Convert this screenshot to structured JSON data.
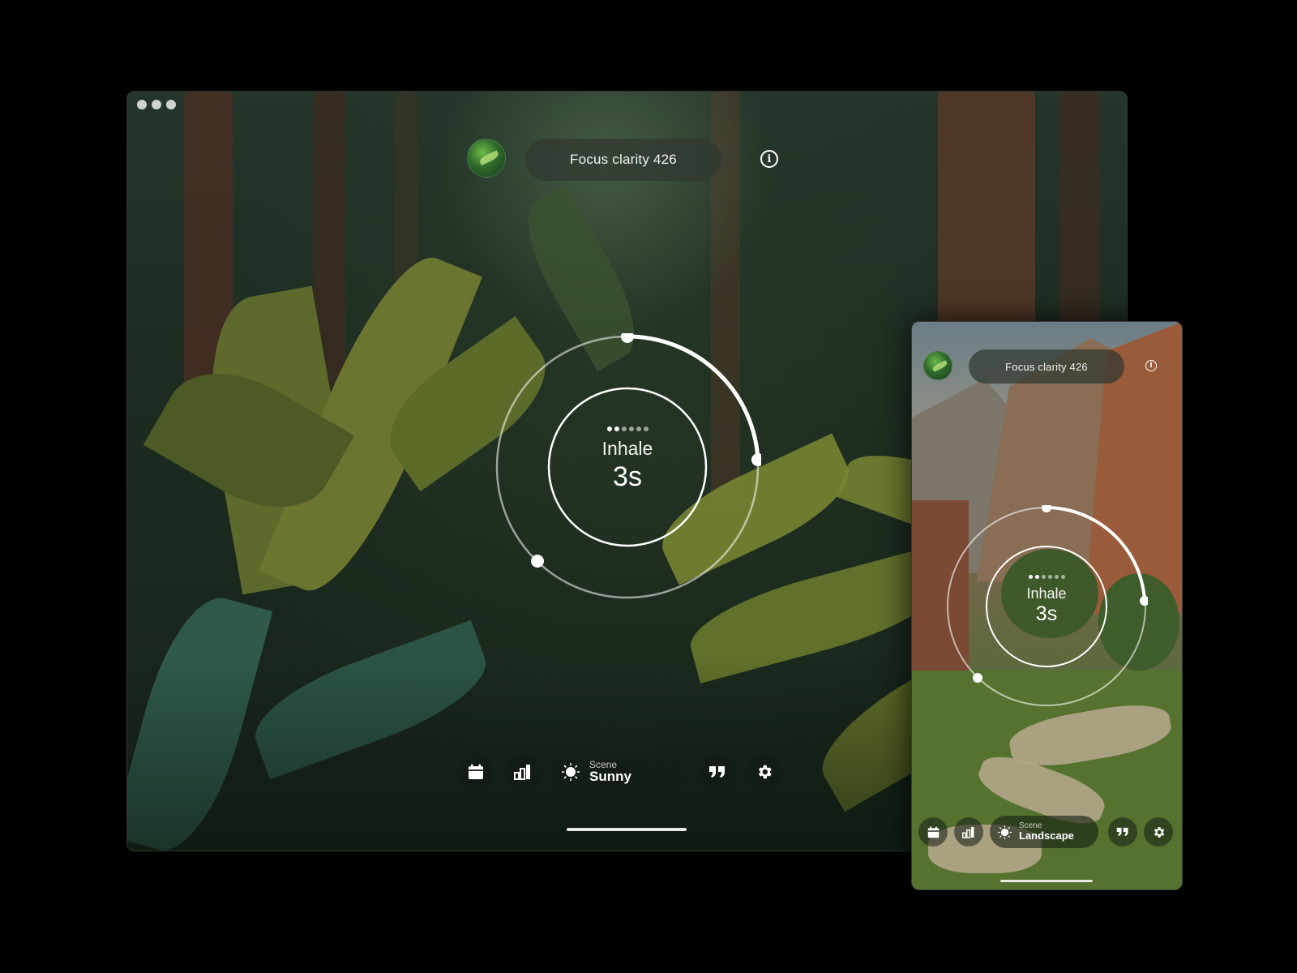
{
  "desktop": {
    "header": {
      "title": "Focus clarity 426",
      "info_icon": "info-icon",
      "avatar_icon": "fern-avatar-icon"
    },
    "breath": {
      "phase": "Inhale",
      "seconds": "3s",
      "step_dots_total": 6,
      "step_dots_active": 2,
      "progress_fraction": 0.27
    },
    "dock": {
      "calendar_icon": "calendar-icon",
      "stats_icon": "bar-chart-icon",
      "scene_icon": "sun-icon",
      "scene_label": "Scene",
      "scene_value": "Sunny",
      "quote_icon": "quote-icon",
      "settings_icon": "gear-icon"
    }
  },
  "phone": {
    "header": {
      "title": "Focus clarity 426",
      "info_icon": "info-icon",
      "avatar_icon": "fern-avatar-icon"
    },
    "breath": {
      "phase": "Inhale",
      "seconds": "3s",
      "step_dots_total": 6,
      "step_dots_active": 2,
      "progress_fraction": 0.27
    },
    "dock": {
      "calendar_icon": "calendar-icon",
      "stats_icon": "bar-chart-icon",
      "scene_icon": "sun-icon",
      "scene_label": "Scene",
      "scene_value": "Landscape",
      "quote_icon": "quote-icon",
      "settings_icon": "gear-icon"
    }
  },
  "colors": {
    "accent": "#ffffff",
    "pill_bg": "#303830",
    "forest": "#1c2a1f"
  }
}
